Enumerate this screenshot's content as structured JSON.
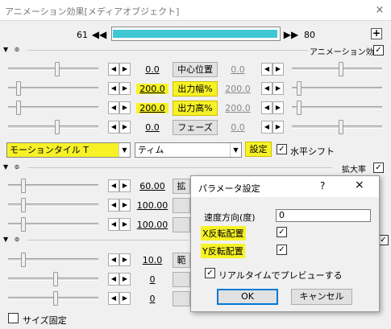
{
  "window": {
    "title": "アニメーション効果[メディアオブジェクト]",
    "close_glyph": "×"
  },
  "timeline": {
    "start_frame": "61",
    "end_frame": "80",
    "prev_glyph": "◀◀",
    "next_glyph": "▶▶",
    "add_glyph": "+",
    "fill_fraction": 0.99
  },
  "sections": {
    "anim1": {
      "label": "アニメーション効果",
      "checked": "✓"
    },
    "zoom": {
      "label": "拡大率",
      "checked": "✓"
    },
    "third": {
      "checked": "✓"
    }
  },
  "params1": [
    {
      "left_value": "0.0",
      "button": "中心位置",
      "right_value": "0.0",
      "highlight": false
    },
    {
      "left_value": "200.0",
      "button": "出力幅%",
      "right_value": "200.0",
      "highlight": true
    },
    {
      "left_value": "200.0",
      "button": "出力高%",
      "right_value": "200.0",
      "highlight": true
    },
    {
      "left_value": "0.0",
      "button": "フェーズ",
      "right_value": "0.0",
      "highlight": false
    }
  ],
  "effect_row": {
    "effect_select": "モーションタイル T",
    "mode_select": "ティム",
    "settings_button": "設定",
    "hshift_checked": "✓",
    "hshift_label": "水平シフト"
  },
  "params2": [
    {
      "left_value": "60.00",
      "button": "拡"
    },
    {
      "left_value": "100.00",
      "button": ""
    },
    {
      "left_value": "100.00",
      "button": ""
    }
  ],
  "params3": [
    {
      "left_value": "10.0",
      "button": "範"
    },
    {
      "left_value": "0",
      "button": ""
    },
    {
      "left_value": "0",
      "button": ""
    }
  ],
  "footer": {
    "size_fix_label": "サイズ固定",
    "size_fix_checked": ""
  },
  "dialog": {
    "title": "パラメータ設定",
    "help_glyph": "?",
    "close_glyph": "×",
    "speed_label": "速度方向(度)",
    "speed_value": "0",
    "xflip_label": "X反転配置",
    "xflip_checked": "✓",
    "yflip_label": "Y反転配置",
    "yflip_checked": "✓",
    "realtime_checked": "✓",
    "realtime_label": "リアルタイムでプレビューする",
    "ok_button": "OK",
    "cancel_button": "キャンセル"
  },
  "icons": {
    "arrow_left": "◀",
    "arrow_right": "▶",
    "dropdown": "▼",
    "section_toggle": "▼",
    "lock": "⍨"
  }
}
